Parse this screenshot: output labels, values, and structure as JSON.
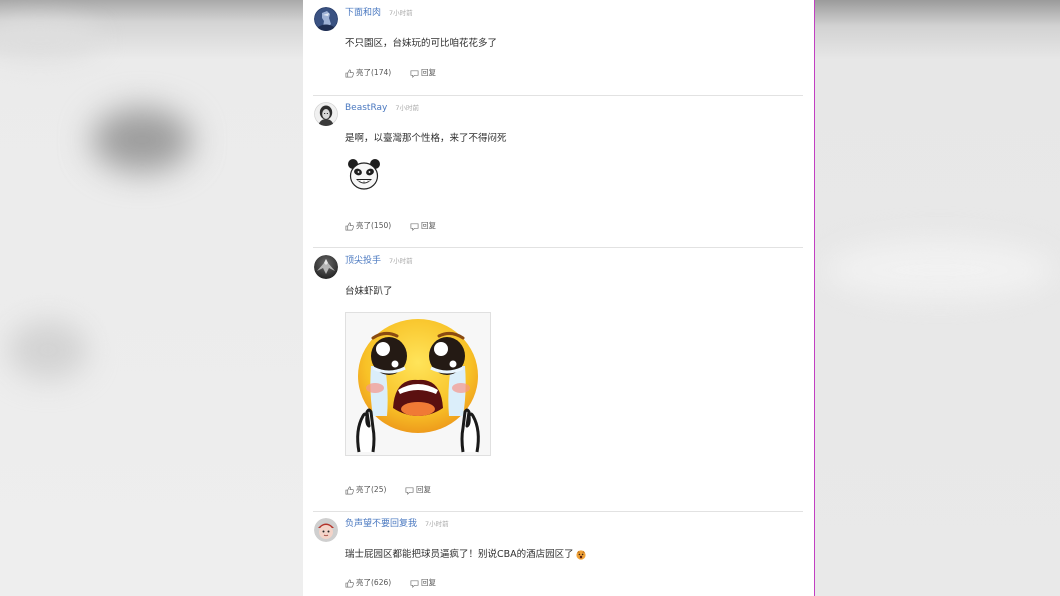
{
  "colors": {
    "username": "#4a78c0",
    "accent_line": "#c23fc2",
    "panel_background": "#ffffff"
  },
  "comments": [
    {
      "avatar": "dark-blue-figure-avatar",
      "username": "下面和肉",
      "time": "7小时前",
      "content": "不只園区，台妹玩的可比咱花花多了",
      "likes": "亮了(174)",
      "reply": "回复"
    },
    {
      "avatar": "grayscale-portrait-avatar",
      "username": "BeastRay",
      "time": "7小时前",
      "content": "是啊，以臺灣那个性格，来了不得闷死",
      "sticker": "panda-meme-sticker",
      "likes": "亮了(150)",
      "reply": "回复"
    },
    {
      "avatar": "dark-silhouette-avatar",
      "username": "顶尖投手",
      "time": "7小时前",
      "content": "台妹虾趴了",
      "sticker": "crying-face-sticker",
      "likes": "亮了(25)",
      "reply": "回复"
    },
    {
      "avatar": "cartoon-avatar",
      "username": "负声望不要回复我",
      "time": "7小时前",
      "content": "瑞士屁园区都能把球员逼疯了！别说CBA的酒店园区了",
      "emoji": "shocked-face-emoji",
      "likes": "亮了(626)",
      "reply": "回复"
    }
  ]
}
